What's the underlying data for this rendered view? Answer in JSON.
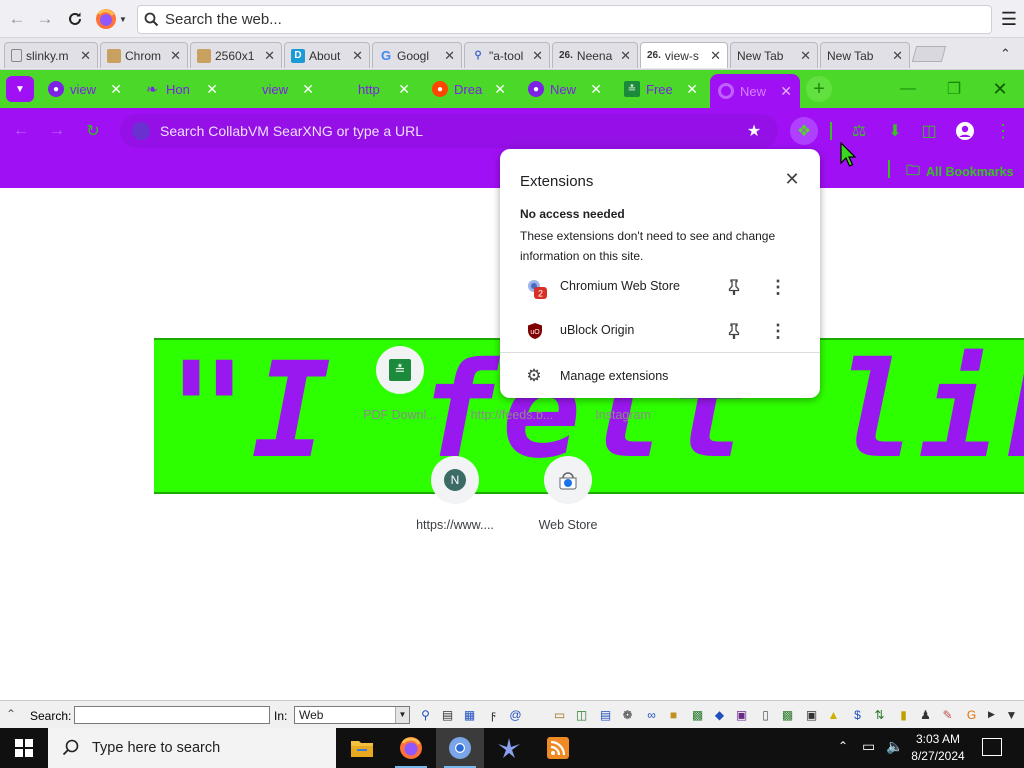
{
  "firefox": {
    "url_placeholder": "Search the web...",
    "tabs": [
      {
        "label": "slinky.m",
        "icon": "page-icon",
        "color": "#555555"
      },
      {
        "label": "Chrom",
        "icon": "image-icon",
        "color": "#8a6a30"
      },
      {
        "label": "2560x1",
        "icon": "image-icon",
        "color": "#8a6a30"
      },
      {
        "label": "About",
        "icon": "d-logo-icon",
        "color": "#1a9ad6"
      },
      {
        "label": "Googl",
        "icon": "google-icon",
        "color": "#4285f4"
      },
      {
        "label": "\"a-tool",
        "icon": "search-icon",
        "color": "#4466cc"
      },
      {
        "label": "Neena",
        "icon": "number-26-icon",
        "color": "#333333"
      },
      {
        "label": "view-s",
        "icon": "number-26-icon",
        "color": "#333333"
      },
      {
        "label": "New Tab",
        "icon": "none",
        "color": "#333333"
      },
      {
        "label": "New Tab",
        "icon": "none",
        "color": "#333333"
      }
    ],
    "tab_number_badge": "26."
  },
  "chromium": {
    "tabs": [
      {
        "label": "view",
        "icon": "globe-icon"
      },
      {
        "label": "Hon",
        "icon": "leaf-icon"
      },
      {
        "label": "view",
        "icon": "none"
      },
      {
        "label": "http",
        "icon": "none"
      },
      {
        "label": "Drea",
        "icon": "reddit-icon"
      },
      {
        "label": "New",
        "icon": "globe-icon"
      },
      {
        "label": "Free",
        "icon": "download-badge-icon"
      },
      {
        "label": "New",
        "icon": "chrome-icon",
        "active": true
      }
    ],
    "omnibox_placeholder": "Search CollabVM SearXNG or type a URL",
    "bookmarks": {
      "all_label": "All Bookmarks"
    },
    "colors": {
      "frame": "#4bd828",
      "toolbar": "#a010f5",
      "active_tab": "#a010f5"
    }
  },
  "new_tab_page": {
    "banner_text": "\"I felt like a ca",
    "shortcuts": [
      {
        "label": "PDF Downl...",
        "icon": "download-badge-icon",
        "dimmed": true
      },
      {
        "label": "http://feeds.b...",
        "icon": "globe-icon",
        "dimmed": true
      },
      {
        "label": "Instagram",
        "icon": "globe-icon",
        "dimmed": true
      },
      {
        "label": "https://www....",
        "icon": "letter-n-icon",
        "letter": "N"
      },
      {
        "label": "Web Store",
        "icon": "chrome-web-store-icon"
      }
    ]
  },
  "extensions_popup": {
    "title": "Extensions",
    "section_title": "No access needed",
    "section_desc": "These extensions don't need to see and change information on this site.",
    "items": [
      {
        "name": "Chromium Web Store",
        "icon": "chromium-web-store-icon",
        "badge": "2"
      },
      {
        "name": "uBlock Origin",
        "icon": "ublock-origin-icon",
        "badge": ""
      }
    ],
    "manage_label": "Manage extensions"
  },
  "search_toolbar": {
    "search_label": "Search:",
    "in_label": "In:",
    "scope_value": "Web"
  },
  "taskbar": {
    "search_placeholder": "Type here to search",
    "time": "3:03 AM",
    "date": "8/27/2024"
  }
}
